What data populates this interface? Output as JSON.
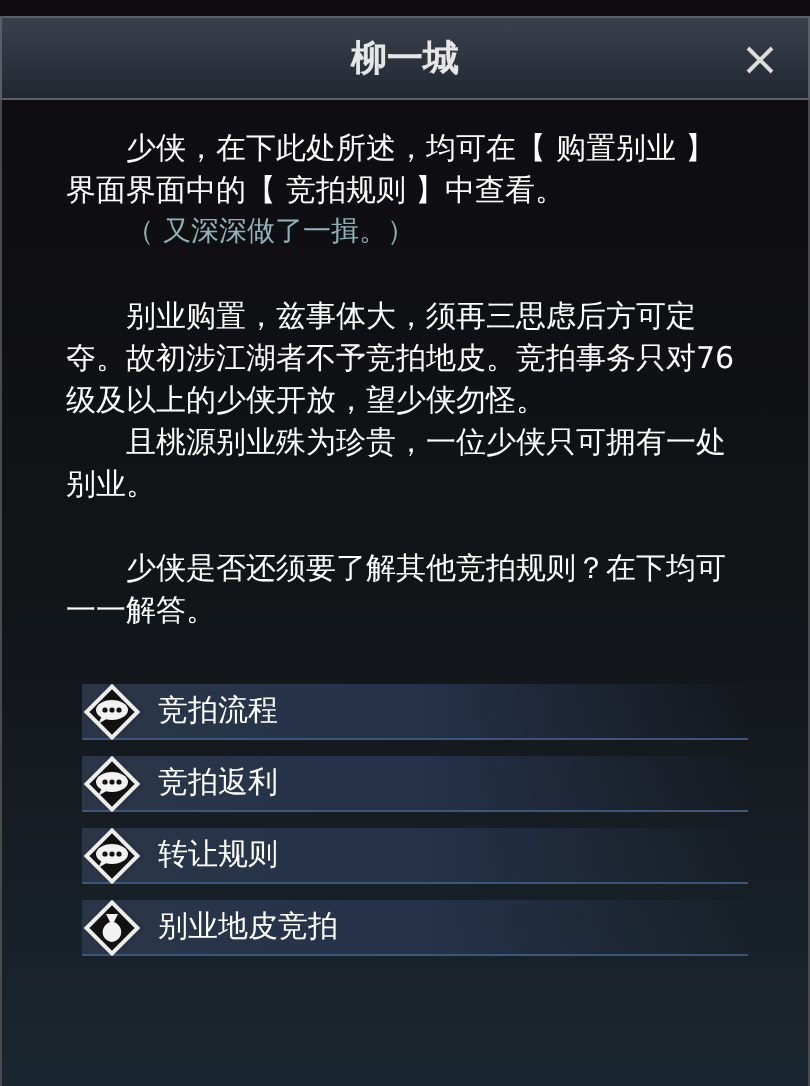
{
  "window": {
    "title": "柳一城"
  },
  "paragraphs": [
    {
      "lines": [
        "少侠，在下此处所述，均可在【 购置别业 】界面界面中的【 竞拍规则 】中查看。"
      ],
      "note": "（ 又深深做了一揖。）"
    },
    {
      "lines": [
        "别业购置，兹事体大，须再三思虑后方可定夺。故初涉江湖者不予竞拍地皮。竞拍事务只对76级及以上的少侠开放，望少侠勿怪。",
        "且桃源别业殊为珍贵，一位少侠只可拥有一处别业。"
      ]
    },
    {
      "lines": [
        "少侠是否还须要了解其他竞拍规则？在下均可一一解答。"
      ]
    }
  ],
  "options": [
    {
      "kind": "chat",
      "label": "竞拍流程"
    },
    {
      "kind": "chat",
      "label": "竞拍返利"
    },
    {
      "kind": "chat",
      "label": "转让规则"
    },
    {
      "kind": "bag",
      "label": "别业地皮竞拍"
    }
  ]
}
